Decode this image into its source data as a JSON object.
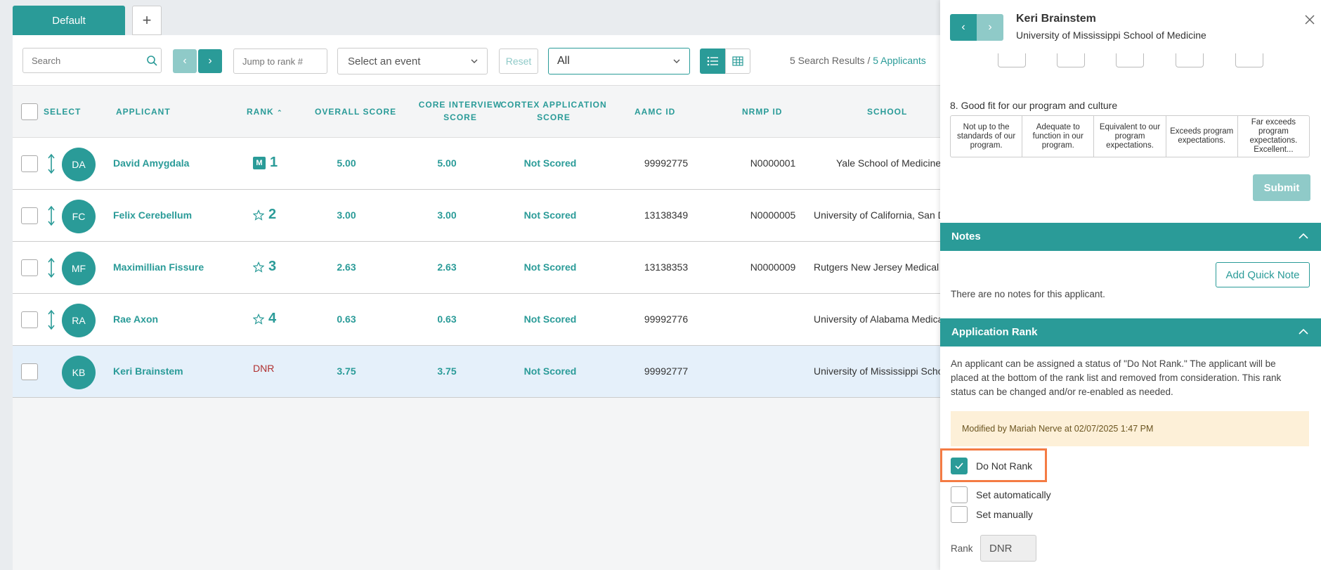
{
  "tabs": {
    "default_label": "Default",
    "add_label": "+"
  },
  "toolbar": {
    "search_placeholder": "Search",
    "jump_placeholder": "Jump to rank #",
    "event_select": "Select an event",
    "reset_label": "Reset",
    "filter_value": "All",
    "results_prefix": "5 Search Results /",
    "results_link": "5 Applicants"
  },
  "table": {
    "headers": {
      "select": "SELECT",
      "applicant": "APPLICANT",
      "rank": "RANK",
      "overall": "OVERALL SCORE",
      "core_interview_1": "CORE INTERVIEW",
      "core_interview_2": "SCORE",
      "cortex_1": "CORTEX APPLICATION",
      "cortex_2": "SCORE",
      "aamc": "AAMC ID",
      "nrmp": "NRMP ID",
      "school": "SCHOOL"
    },
    "rows": [
      {
        "initials": "DA",
        "name": "David Amygdala",
        "badge": "M",
        "rank": "1",
        "overall": "5.00",
        "core": "5.00",
        "cortex": "Not Scored",
        "aamc": "99992775",
        "nrmp": "N0000001",
        "school": "Yale School of Medicine"
      },
      {
        "initials": "FC",
        "name": "Felix Cerebellum",
        "badge": "star",
        "rank": "2",
        "overall": "3.00",
        "core": "3.00",
        "cortex": "Not Scored",
        "aamc": "13138349",
        "nrmp": "N0000005",
        "school": "University of California, San D"
      },
      {
        "initials": "MF",
        "name": "Maximillian Fissure",
        "badge": "star",
        "rank": "3",
        "overall": "2.63",
        "core": "2.63",
        "cortex": "Not Scored",
        "aamc": "13138353",
        "nrmp": "N0000009",
        "school": "Rutgers New Jersey Medical"
      },
      {
        "initials": "RA",
        "name": "Rae Axon",
        "badge": "star",
        "rank": "4",
        "overall": "0.63",
        "core": "0.63",
        "cortex": "Not Scored",
        "aamc": "99992776",
        "nrmp": "",
        "school": "University of Alabama Medica"
      },
      {
        "initials": "KB",
        "name": "Keri Brainstem",
        "badge": "",
        "rank": "DNR",
        "overall": "3.75",
        "core": "3.75",
        "cortex": "Not Scored",
        "aamc": "99992777",
        "nrmp": "",
        "school": "University of Mississippi Scho"
      }
    ]
  },
  "side": {
    "name": "Keri Brainstem",
    "school": "University of Mississippi School of Medicine",
    "question8": "8. Good fit for our program and culture",
    "scale": [
      "Not up to the standards of our program.",
      "Adequate to function in our program.",
      "Equivalent to our program expectations.",
      "Exceeds program expectations.",
      "Far exceeds program expectations. Excellent..."
    ],
    "submit_label": "Submit",
    "notes_title": "Notes",
    "add_note_label": "Add Quick Note",
    "no_notes": "There are no notes for this applicant.",
    "app_rank_title": "Application Rank",
    "rank_desc": "An applicant can be assigned a status of \"Do Not Rank.\" The applicant will be placed at the bottom of the rank list and removed from consideration. This rank status can be changed and/or re-enabled as needed.",
    "modified_text": "Modified by Mariah Nerve at 02/07/2025 1:47 PM",
    "opt_dnr": "Do Not Rank",
    "opt_auto": "Set automatically",
    "opt_manual": "Set manually",
    "rank_label": "Rank",
    "rank_value": "DNR"
  },
  "colors": {
    "accent": "#2a9b98",
    "accent_light": "#8fcac8",
    "dnr": "#b03030",
    "highlight": "#f47b44"
  }
}
